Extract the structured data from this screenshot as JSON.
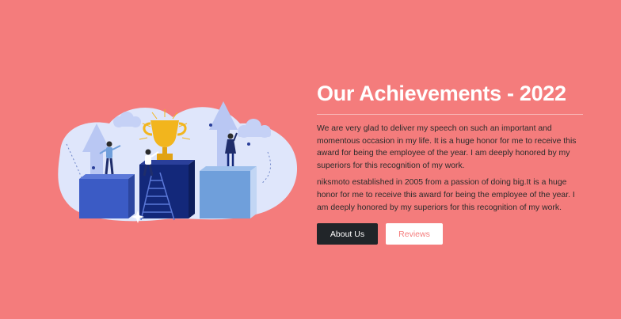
{
  "section": {
    "title": "Our Achievements - 2022",
    "paragraph_1": "We are very glad to deliver my speech on such an important and momentous occasion in my life. It is a huge honor for me to receive this award for being the employee of the year. I am deeply honored by my superiors for this recognition of my work.",
    "paragraph_2": "niksmoto established in 2005 from a passion of doing big.It is a huge honor for me to receive this award for being the employee of the year. I am deeply honored by my superiors for this recognition of my work.",
    "about_button": "About Us",
    "reviews_button": "Reviews"
  },
  "colors": {
    "background": "#f47c7c",
    "dark_button": "#212529",
    "light_button": "#ffffff",
    "trophy": "#f2b51d",
    "podium_blue": "#3b5bc5",
    "podium_navy": "#13287a",
    "podium_light": "#6f9fdb"
  },
  "icons": [
    "trophy-illustration",
    "ladder-icon",
    "arrow-icon",
    "cloud-icon",
    "person-icon"
  ]
}
